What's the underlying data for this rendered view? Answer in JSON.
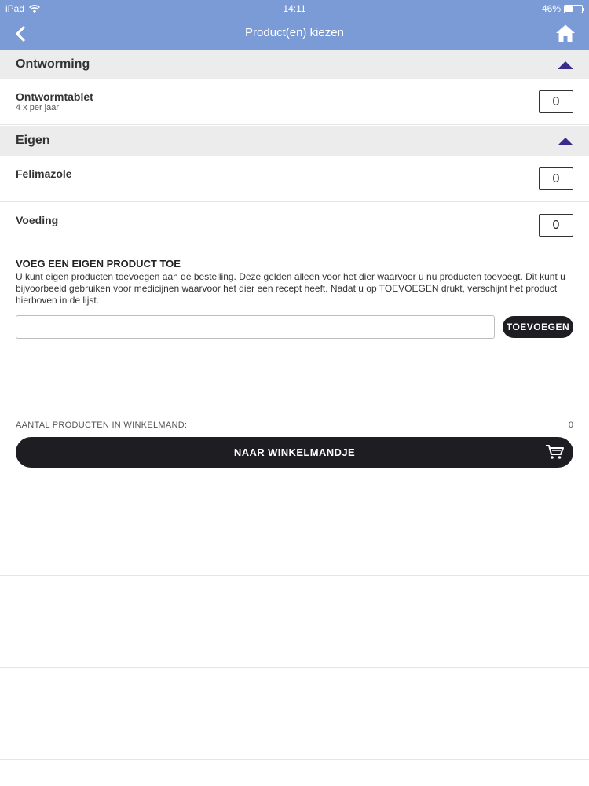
{
  "status_bar": {
    "device": "iPad",
    "time": "14:11",
    "battery": "46%",
    "battery_level": 0.46
  },
  "nav": {
    "title": "Product(en) kiezen"
  },
  "sections": [
    {
      "title": "Ontworming",
      "items": [
        {
          "name": "Ontwormtablet",
          "subtitle": "4 x per jaar",
          "quantity": "0"
        }
      ]
    },
    {
      "title": "Eigen",
      "items": [
        {
          "name": "Felimazole",
          "quantity": "0"
        },
        {
          "name": "Voeding",
          "quantity": "0"
        }
      ]
    }
  ],
  "add_product": {
    "title": "VOEG EEN EIGEN PRODUCT TOE",
    "description": "U kunt eigen producten toevoegen aan de bestelling. Deze gelden alleen voor het dier waarvoor u nu producten toevoegt. Dit kunt u bijvoorbeeld gebruiken voor medicijnen waarvoor het dier een recept heeft. Nadat u op TOEVOEGEN drukt, verschijnt het product hierboven in de lijst.",
    "input_value": "",
    "button_label": "TOEVOEGEN"
  },
  "cart": {
    "count_label": "AANTAL PRODUCTEN IN WINKELMAND:",
    "count_value": "0",
    "button_label": "NAAR WINKELMANDJE"
  },
  "colors": {
    "header_blue": "#7b9bd6",
    "accent_purple": "#3a2a8a",
    "button_dark": "#1e1e22"
  }
}
